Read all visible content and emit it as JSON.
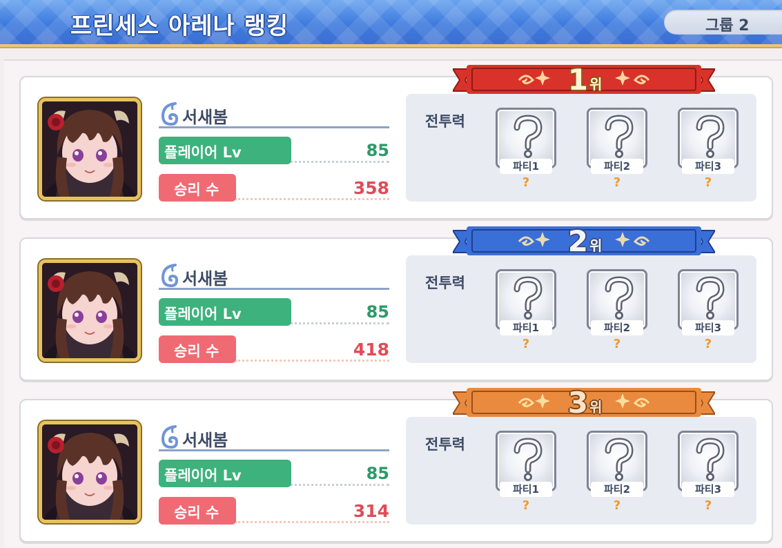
{
  "header": {
    "title": "프린세스 아레나 랭킹",
    "group_label": "그룹 2"
  },
  "ranking": [
    {
      "rank": "1",
      "rank_suffix": "위",
      "banner_color": "#d8322b",
      "banner_edge": "#8f1a16",
      "player_name": "서새봄",
      "level_label": "플레이어 Lv",
      "level": "85",
      "wins_label": "승리 수",
      "wins": "358",
      "power_label": "전투력",
      "parties": [
        {
          "name": "파티1",
          "power": "?"
        },
        {
          "name": "파티2",
          "power": "?"
        },
        {
          "name": "파티3",
          "power": "?"
        }
      ]
    },
    {
      "rank": "2",
      "rank_suffix": "위",
      "banner_color": "#3a6fd8",
      "banner_edge": "#1f3f8f",
      "player_name": "서새봄",
      "level_label": "플레이어 Lv",
      "level": "85",
      "wins_label": "승리 수",
      "wins": "418",
      "power_label": "전투력",
      "parties": [
        {
          "name": "파티1",
          "power": "?"
        },
        {
          "name": "파티2",
          "power": "?"
        },
        {
          "name": "파티3",
          "power": "?"
        }
      ]
    },
    {
      "rank": "3",
      "rank_suffix": "위",
      "banner_color": "#e98a3e",
      "banner_edge": "#9a4f1a",
      "player_name": "서새봄",
      "level_label": "플레이어 Lv",
      "level": "85",
      "wins_label": "승리 수",
      "wins": "314",
      "power_label": "전투력",
      "parties": [
        {
          "name": "파티1",
          "power": "?"
        },
        {
          "name": "파티2",
          "power": "?"
        },
        {
          "name": "파티3",
          "power": "?"
        }
      ]
    }
  ]
}
